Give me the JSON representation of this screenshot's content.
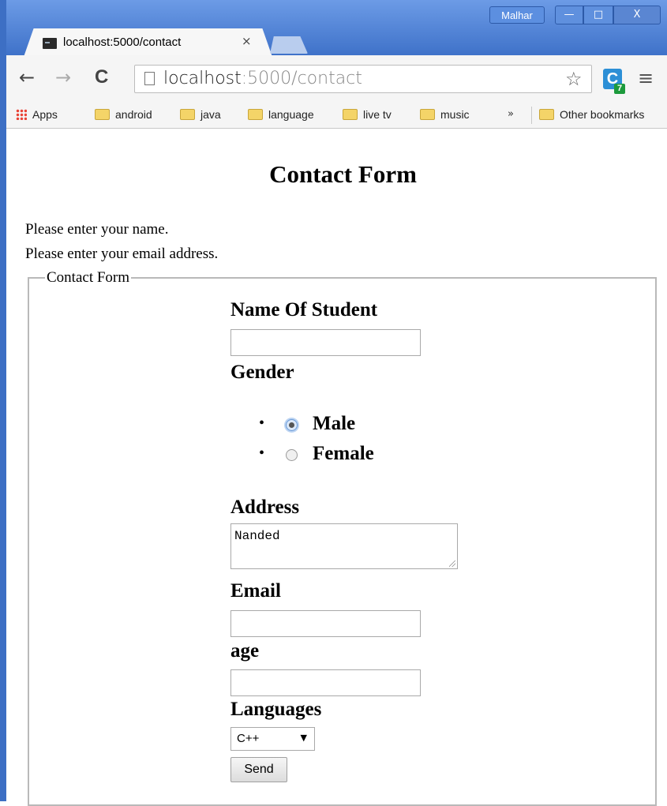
{
  "window": {
    "user": "Malhar",
    "min": "—",
    "max": "□",
    "close": "X"
  },
  "tab": {
    "title": "localhost:5000/contact",
    "close": "×"
  },
  "toolbar": {
    "back": "←",
    "forward": "→",
    "reload": "C",
    "url_host": "localhost",
    "url_rest": ":5000/contact",
    "star": "☆",
    "extension": "C",
    "extension_badge": "7",
    "menu": "≡"
  },
  "bookmarks": {
    "items": [
      "Apps",
      "android",
      "java",
      "language",
      "live tv",
      "music"
    ],
    "more": "»",
    "other": "Other bookmarks"
  },
  "page": {
    "title": "Contact Form",
    "messages": [
      "Please enter your name.",
      "Please enter your email address."
    ],
    "legend": "Contact Form",
    "fields": {
      "name_label": "Name Of Student",
      "name_value": "",
      "gender_label": "Gender",
      "gender_options": [
        "Male",
        "Female"
      ],
      "gender_selected": "Male",
      "address_label": "Address",
      "address_value": "Nanded",
      "email_label": "Email",
      "email_value": "",
      "age_label": "age",
      "age_value": "",
      "languages_label": "Languages",
      "language_selected": "C++",
      "submit": "Send"
    }
  }
}
